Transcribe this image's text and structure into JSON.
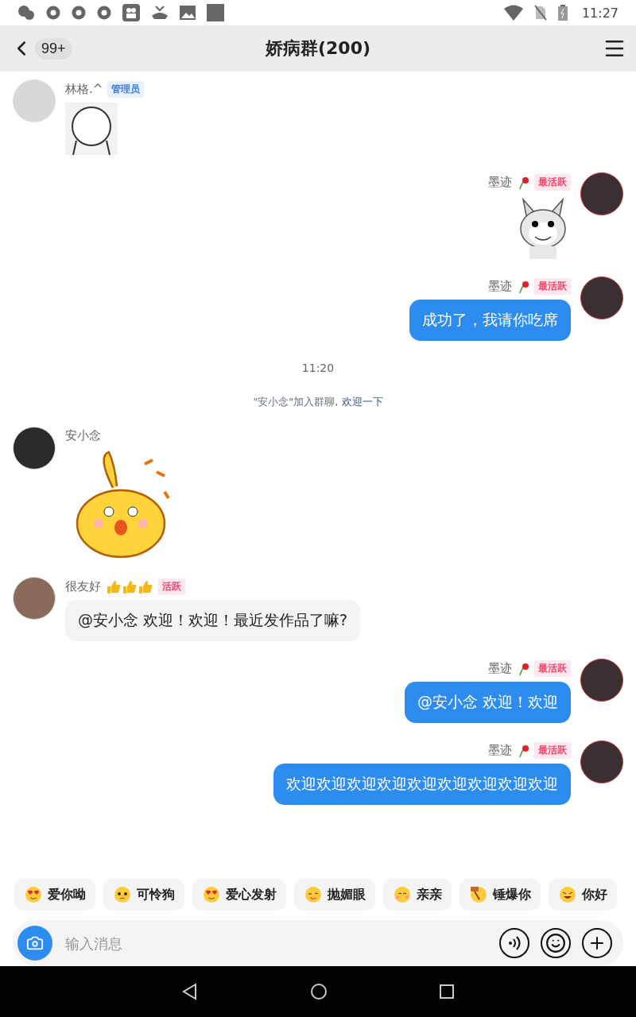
{
  "status_bar": {
    "time": "11:27"
  },
  "header": {
    "back_count": "99+",
    "title": "娇病群(200)"
  },
  "messages": [
    {
      "kind": "sticker",
      "outgoing": false,
      "name": "林格.^",
      "badge": {
        "text": "管理员",
        "kind": "admin"
      },
      "sticker": {
        "kind": "grey"
      }
    },
    {
      "kind": "sticker",
      "outgoing": true,
      "name": "墨迹",
      "decor": {
        "kind": "rose"
      },
      "badge": {
        "text": "最活跃",
        "kind": "active"
      },
      "sticker": {
        "kind": "rabbit"
      }
    },
    {
      "kind": "text",
      "outgoing": true,
      "name": "墨迹",
      "decor": {
        "kind": "rose"
      },
      "badge": {
        "text": "最活跃",
        "kind": "active"
      },
      "text": "成功了，我请你吃席"
    },
    {
      "kind": "time",
      "text": "11:20"
    },
    {
      "kind": "system",
      "text": "\"安小念\"加入群聊, ",
      "link": "欢迎一下"
    },
    {
      "kind": "sticker",
      "outgoing": false,
      "name": "安小念",
      "sticker": {
        "kind": "cat"
      }
    },
    {
      "kind": "text",
      "outgoing": false,
      "name": "很友好",
      "decor": {
        "kind": "thumbs"
      },
      "badge": {
        "text": "活跃",
        "kind": "active"
      },
      "text": "@安小念 欢迎！欢迎！最近发作品了嘛?"
    },
    {
      "kind": "text",
      "outgoing": true,
      "name": "墨迹",
      "decor": {
        "kind": "rose"
      },
      "badge": {
        "text": "最活跃",
        "kind": "active"
      },
      "text": "@安小念 欢迎！欢迎"
    },
    {
      "kind": "text",
      "outgoing": true,
      "name": "墨迹",
      "decor": {
        "kind": "rose"
      },
      "badge": {
        "text": "最活跃",
        "kind": "active"
      },
      "text": "欢迎欢迎欢迎欢迎欢迎欢迎欢迎欢迎欢迎"
    }
  ],
  "quick_replies": [
    {
      "label": "爱你呦",
      "icon": {
        "kind": "heart"
      }
    },
    {
      "label": "可怜狗",
      "icon": {
        "kind": "dog"
      }
    },
    {
      "label": "爱心发射",
      "icon": {
        "kind": "heart"
      }
    },
    {
      "label": "抛媚眼",
      "icon": {
        "kind": "wink"
      }
    },
    {
      "label": "亲亲",
      "icon": {
        "kind": "smile"
      }
    },
    {
      "label": "锤爆你",
      "icon": {
        "kind": "hammer"
      }
    },
    {
      "label": "你好",
      "icon": {
        "kind": "laugh"
      }
    }
  ],
  "composer": {
    "placeholder": "输入消息"
  }
}
